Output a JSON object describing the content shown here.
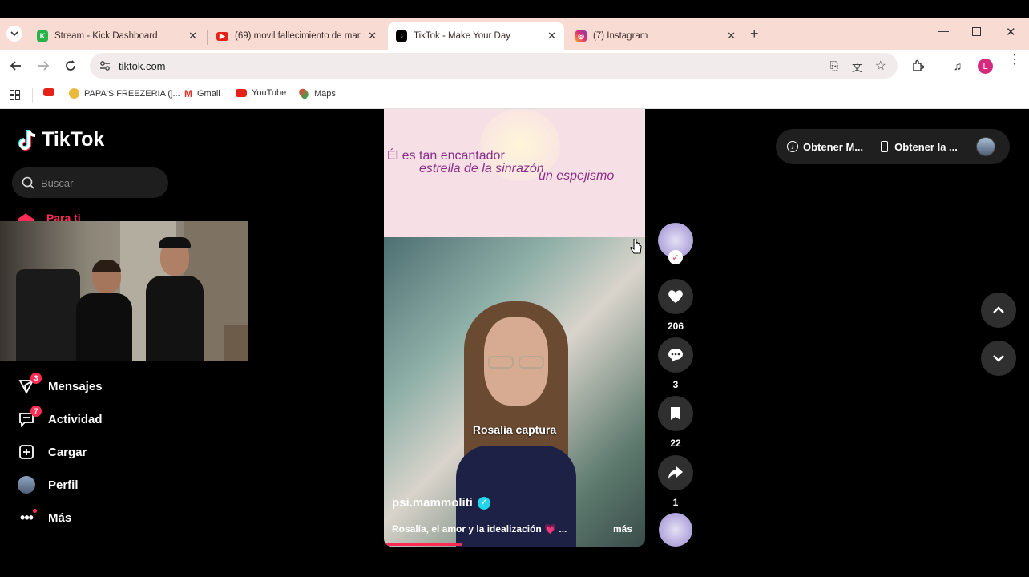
{
  "browser": {
    "tabs": [
      {
        "title": "Stream - Kick Dashboard",
        "icon": "kick-icon"
      },
      {
        "title": "(69) movil fallecimiento de mar",
        "icon": "youtube-icon"
      },
      {
        "title": "TikTok - Make Your Day",
        "icon": "tiktok-icon"
      },
      {
        "title": "(7) Instagram",
        "icon": "instagram-icon"
      }
    ],
    "url": "tiktok.com",
    "bookmarks": [
      {
        "label": "",
        "icon": "youtube-icon"
      },
      {
        "label": "PAPA'S FREEZERIA (j...",
        "icon": "papas-icon"
      },
      {
        "label": "Gmail",
        "icon": "gmail-icon"
      },
      {
        "label": "YouTube",
        "icon": "youtube-icon"
      },
      {
        "label": "Maps",
        "icon": "maps-icon"
      }
    ],
    "profile_initial": "L"
  },
  "sidebar": {
    "logo": "TikTok",
    "search_placeholder": "Buscar",
    "para_ti": "Para ti",
    "items": [
      {
        "label": "Mensajes",
        "badge": "3",
        "icon": "inbox-icon"
      },
      {
        "label": "Actividad",
        "badge": "7",
        "icon": "activity-icon"
      },
      {
        "label": "Cargar",
        "icon": "upload-icon"
      },
      {
        "label": "Perfil",
        "icon": "profile-avatar"
      },
      {
        "label": "Más",
        "icon": "more-icon"
      }
    ]
  },
  "video": {
    "lyrics": [
      "Él es tan encantador",
      "estrella de la sinrazón",
      "un espejismo"
    ],
    "caption": "Rosalía captura",
    "username": "psi.mammoliti",
    "description": "Rosalía, el amor y la idealización 💗 ...",
    "more": "más",
    "progress": 0.3
  },
  "actions": {
    "likes": "206",
    "comments": "3",
    "saves": "22",
    "shares": "1"
  },
  "topright": {
    "coins": "Obtener M...",
    "app": "Obtener la ..."
  },
  "colors": {
    "brand": "#fe2c55",
    "tabstrip": "#f8dcd4"
  }
}
